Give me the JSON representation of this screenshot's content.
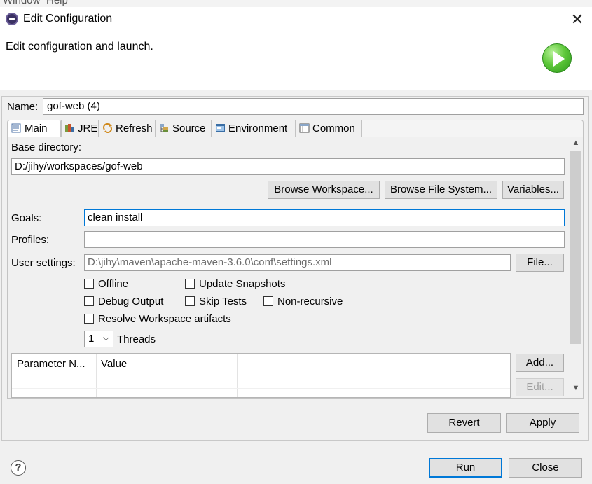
{
  "under_menu": {
    "items": [
      "Window",
      "Help"
    ]
  },
  "window": {
    "title": "Edit Configuration",
    "close_symbol": "✕"
  },
  "header": {
    "text": "Edit configuration and launch.",
    "icon": "run-icon"
  },
  "name": {
    "label": "Name:",
    "value": "gof-web (4)"
  },
  "tabs": [
    {
      "label": "Main",
      "icon": "main-tab-icon",
      "active": true
    },
    {
      "label": "JRE",
      "icon": "jre-icon",
      "active": false
    },
    {
      "label": "Refresh",
      "icon": "refresh-icon",
      "active": false
    },
    {
      "label": "Source",
      "icon": "source-icon",
      "active": false
    },
    {
      "label": "Environment",
      "icon": "environment-icon",
      "active": false
    },
    {
      "label": "Common",
      "icon": "common-icon",
      "active": false
    }
  ],
  "main": {
    "base_directory": {
      "label": "Base directory:",
      "value": "D:/jihy/workspaces/gof-web",
      "buttons": [
        "Browse Workspace...",
        "Browse File System...",
        "Variables..."
      ]
    },
    "goals": {
      "label": "Goals:",
      "value": "clean install"
    },
    "profiles": {
      "label": "Profiles:",
      "value": ""
    },
    "user_settings": {
      "label": "User settings:",
      "value": "D:\\jihy\\maven\\apache-maven-3.6.0\\conf\\settings.xml",
      "button": "File..."
    },
    "checkboxes": {
      "offline": {
        "label": "Offline",
        "checked": false
      },
      "update_snapshots": {
        "label": "Update Snapshots",
        "checked": false
      },
      "debug_output": {
        "label": "Debug Output",
        "checked": false
      },
      "skip_tests": {
        "label": "Skip Tests",
        "checked": false
      },
      "non_recursive": {
        "label": "Non-recursive",
        "checked": false
      },
      "resolve_workspace": {
        "label": "Resolve Workspace artifacts",
        "checked": false
      }
    },
    "threads": {
      "value": "1",
      "label": "Threads"
    },
    "parameters": {
      "columns": [
        "Parameter N...",
        "Value"
      ],
      "rows": [],
      "buttons": {
        "add": "Add...",
        "edit": "Edit..."
      }
    }
  },
  "footer": {
    "revert": "Revert",
    "apply": "Apply",
    "run": "Run",
    "close": "Close",
    "help_symbol": "?"
  },
  "colors": {
    "focus_border": "#0078d7",
    "panel_bg": "#f0f0f0",
    "run_icon_green": "#5ec83a"
  }
}
